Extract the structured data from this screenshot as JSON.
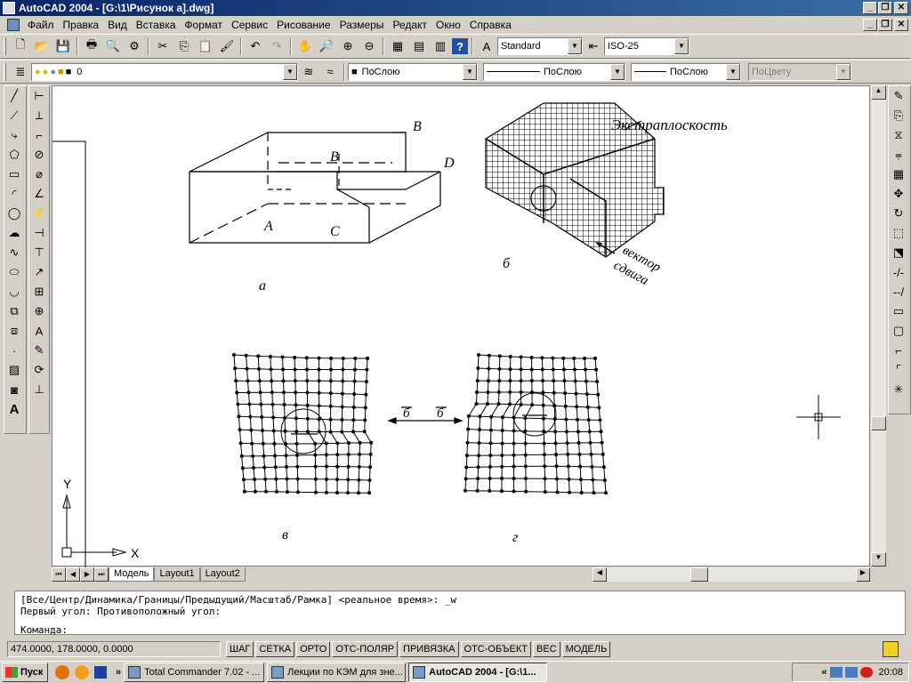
{
  "app": {
    "title": "AutoCAD 2004 - [G:\\1\\Рисунок а].dwg]",
    "window_buttons": [
      "_",
      "❐",
      "✕"
    ]
  },
  "menu": {
    "items": [
      "Файл",
      "Правка",
      "Вид",
      "Вставка",
      "Формат",
      "Сервис",
      "Рисование",
      "Размеры",
      "Редакт",
      "Окно",
      "Справка"
    ]
  },
  "toolbar": {
    "text_style": "Standard",
    "dim_style": "ISO-25",
    "layer": "0",
    "color": "ПоСлою",
    "linetype": "ПоСлою",
    "lineweight": "ПоСлою",
    "plotstyle": "ПоЦвету"
  },
  "drawing": {
    "label_a": "а",
    "label_b": "б",
    "label_v": "в",
    "label_g": "г",
    "pt_A": "A",
    "pt_B": "B",
    "pt_B2": "B",
    "pt_C": "C",
    "pt_D": "D",
    "extraplane": "Экстраплоскость",
    "shift_vector_1": "вектор",
    "shift_vector_2": "сдвига",
    "b_vec_1": "б",
    "b_vec_2": "б",
    "axis_x": "X",
    "axis_y": "Y"
  },
  "tabs": {
    "model": "Модель",
    "layout1": "Layout1",
    "layout2": "Layout2"
  },
  "command": {
    "line1": "[Все/Центр/Динамика/Границы/Предыдущий/Масштаб/Рамка] <реальное время>: _w",
    "line2": "Первый угол: Противоположный угол:",
    "prompt": "Команда:"
  },
  "status": {
    "coords": "474.0000, 178.0000, 0.0000",
    "buttons": [
      "ШАГ",
      "СЕТКА",
      "ОРТО",
      "ОТС-ПОЛЯР",
      "ПРИВЯЗКА",
      "ОТС-ОБЪЕКТ",
      "ВЕС",
      "МОДЕЛЬ"
    ]
  },
  "taskbar": {
    "start": "Пуск",
    "more": "»",
    "tasks": [
      "Total Commander 7.02 - ...",
      "Лекции по КЭМ для зне...",
      "AutoCAD 2004 - [G:\\1..."
    ],
    "tray_more": "«",
    "time": "20:08"
  }
}
